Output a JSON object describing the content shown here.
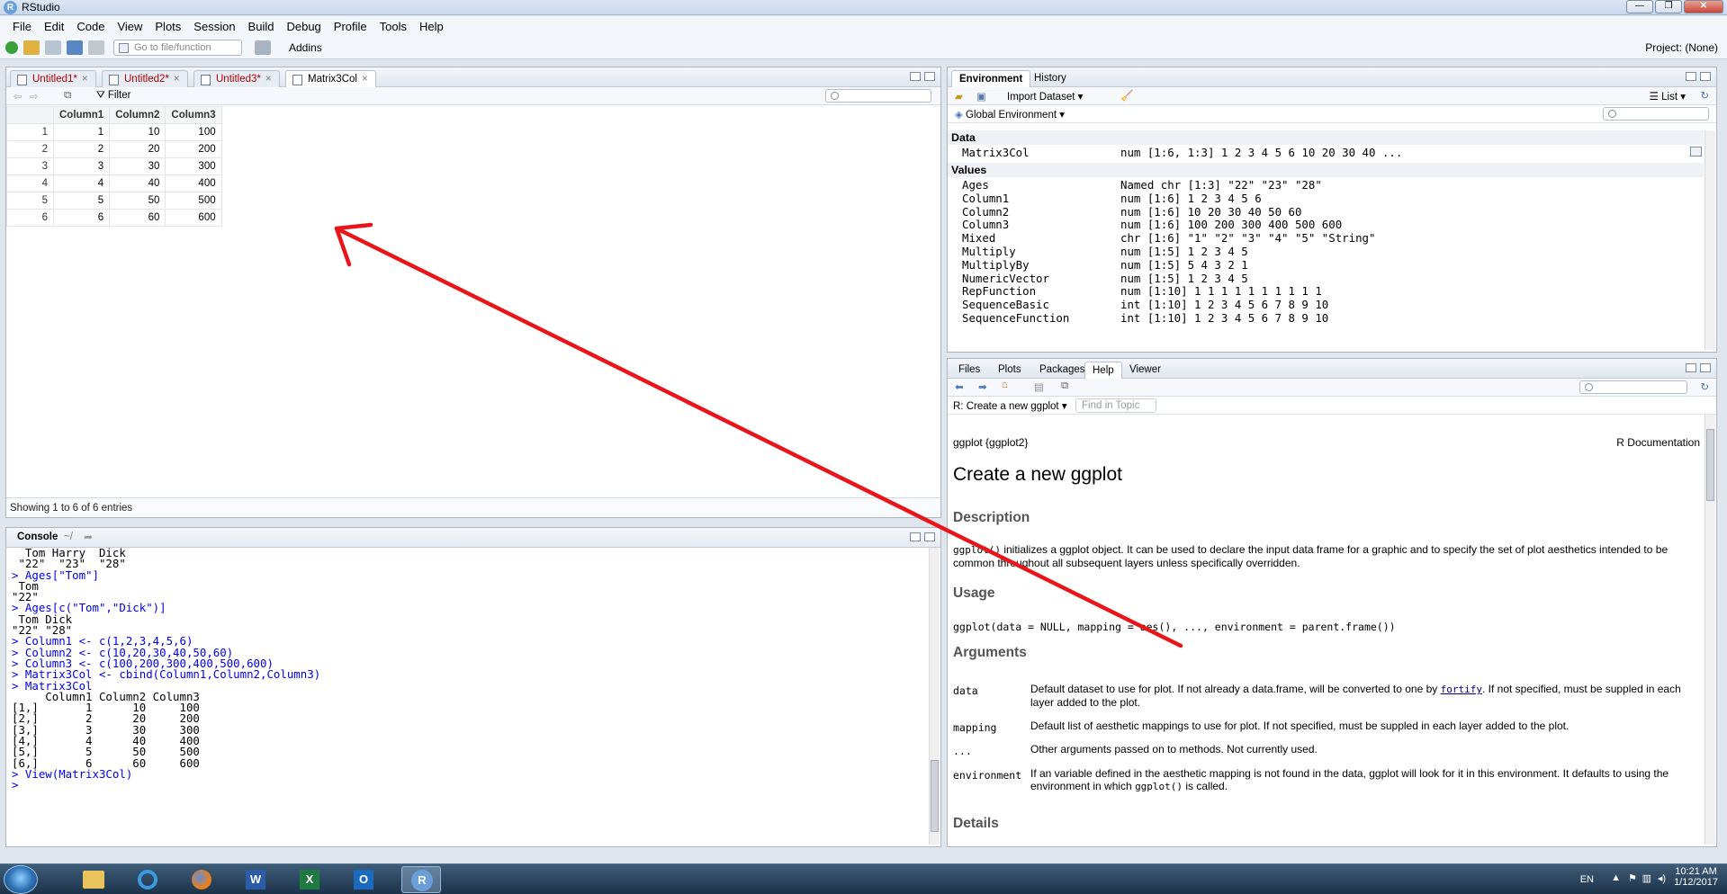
{
  "window": {
    "title": "RStudio",
    "controls": [
      "—",
      "❐",
      "✕"
    ]
  },
  "menu": [
    "File",
    "Edit",
    "Code",
    "View",
    "Plots",
    "Session",
    "Build",
    "Debug",
    "Profile",
    "Tools",
    "Help"
  ],
  "toolbar": {
    "goto_placeholder": "Go to file/function",
    "addins_label": "Addins",
    "project_label": "Project: (None)"
  },
  "source": {
    "tabs": [
      {
        "label": "Untitled1*",
        "modified": true
      },
      {
        "label": "Untitled2*",
        "modified": true
      },
      {
        "label": "Untitled3*",
        "modified": true
      },
      {
        "label": "Matrix3Col",
        "modified": false,
        "active": true
      }
    ],
    "filter_label": "Filter",
    "table": {
      "columns": [
        "",
        "Column1",
        "Column2",
        "Column3"
      ],
      "rows": [
        [
          "1",
          "1",
          "10",
          "100"
        ],
        [
          "2",
          "2",
          "20",
          "200"
        ],
        [
          "3",
          "3",
          "30",
          "300"
        ],
        [
          "4",
          "4",
          "40",
          "400"
        ],
        [
          "5",
          "5",
          "50",
          "500"
        ],
        [
          "6",
          "6",
          "60",
          "600"
        ]
      ]
    },
    "showing": "Showing 1 to 6 of 6 entries"
  },
  "console": {
    "title": "Console",
    "path": "~/",
    "lines": [
      {
        "t": "out",
        "s": "  Tom Harry  Dick "
      },
      {
        "t": "out",
        "s": " \"22\"  \"23\"  \"28\" "
      },
      {
        "t": "cmd",
        "s": "> Ages[\"Tom\"]"
      },
      {
        "t": "out",
        "s": " Tom "
      },
      {
        "t": "out",
        "s": "\"22\" "
      },
      {
        "t": "cmd",
        "s": "> Ages[c(\"Tom\",\"Dick\")]"
      },
      {
        "t": "out",
        "s": " Tom Dick "
      },
      {
        "t": "out",
        "s": "\"22\" \"28\" "
      },
      {
        "t": "cmd",
        "s": "> Column1 <- c(1,2,3,4,5,6)"
      },
      {
        "t": "cmd",
        "s": "> Column2 <- c(10,20,30,40,50,60)"
      },
      {
        "t": "cmd",
        "s": "> Column3 <- c(100,200,300,400,500,600)"
      },
      {
        "t": "cmd",
        "s": "> Matrix3Col <- cbind(Column1,Column2,Column3)"
      },
      {
        "t": "cmd",
        "s": "> Matrix3Col"
      },
      {
        "t": "out",
        "s": "     Column1 Column2 Column3"
      },
      {
        "t": "out",
        "s": "[1,]       1      10     100"
      },
      {
        "t": "out",
        "s": "[2,]       2      20     200"
      },
      {
        "t": "out",
        "s": "[3,]       3      30     300"
      },
      {
        "t": "out",
        "s": "[4,]       4      40     400"
      },
      {
        "t": "out",
        "s": "[5,]       5      50     500"
      },
      {
        "t": "out",
        "s": "[6,]       6      60     600"
      },
      {
        "t": "cmd",
        "s": "> View(Matrix3Col)"
      },
      {
        "t": "cmd",
        "s": "> "
      }
    ]
  },
  "environment": {
    "tabs": [
      "Environment",
      "History"
    ],
    "import_label": "Import Dataset",
    "list_label": "List",
    "scope_label": "Global Environment",
    "data_heading": "Data",
    "data": [
      {
        "name": "Matrix3Col",
        "value": "num [1:6, 1:3] 1 2 3 4 5 6 10 20 30 40 ..."
      }
    ],
    "values_heading": "Values",
    "values": [
      {
        "name": "Ages",
        "value": "Named chr [1:3] \"22\" \"23\" \"28\""
      },
      {
        "name": "Column1",
        "value": "num [1:6] 1 2 3 4 5 6"
      },
      {
        "name": "Column2",
        "value": "num [1:6] 10 20 30 40 50 60"
      },
      {
        "name": "Column3",
        "value": "num [1:6] 100 200 300 400 500 600"
      },
      {
        "name": "Mixed",
        "value": "chr [1:6] \"1\" \"2\" \"3\" \"4\" \"5\" \"String\""
      },
      {
        "name": "Multiply",
        "value": "num [1:5] 1 2 3 4 5"
      },
      {
        "name": "MultiplyBy",
        "value": "num [1:5] 5 4 3 2 1"
      },
      {
        "name": "NumericVector",
        "value": "num [1:5] 1 2 3 4 5"
      },
      {
        "name": "RepFunction",
        "value": "num [1:10] 1 1 1 1 1 1 1 1 1 1"
      },
      {
        "name": "SequenceBasic",
        "value": "int [1:10] 1 2 3 4 5 6 7 8 9 10"
      },
      {
        "name": "SequenceFunction",
        "value": "int [1:10] 1 2 3 4 5 6 7 8 9 10"
      }
    ]
  },
  "help": {
    "tabs": [
      "Files",
      "Plots",
      "Packages",
      "Help",
      "Viewer"
    ],
    "topic_label": "R: Create a new ggplot",
    "find_placeholder": "Find in Topic",
    "pkg": "ggplot {ggplot2}",
    "rdoc": "R Documentation",
    "title": "Create a new ggplot",
    "desc_heading": "Description",
    "desc_code": "ggplot()",
    "desc_text": " initializes a ggplot object. It can be used to declare the input data frame for a graphic and to specify the set of plot aesthetics intended to be common throughout all subsequent layers unless specifically overridden.",
    "usage_heading": "Usage",
    "usage": "ggplot(data = NULL, mapping = aes(), ..., environment = parent.frame())",
    "args_heading": "Arguments",
    "args": [
      {
        "name": "data",
        "pre": "Default dataset to use for plot. If not already a data.frame, will be converted to one by ",
        "link": "fortify",
        "post": ". If not specified, must be suppled in each layer added to the plot."
      },
      {
        "name": "mapping",
        "pre": "Default list of aesthetic mappings to use for plot. If not specified, must be suppled in each layer added to the plot.",
        "link": "",
        "post": ""
      },
      {
        "name": "...",
        "pre": "Other arguments passed on to methods. Not currently used.",
        "link": "",
        "post": ""
      },
      {
        "name": "environment",
        "pre": "If an variable defined in the aesthetic mapping is not found in the data, ggplot will look for it in this environment. It defaults to using the environment in which ",
        "link": "",
        "code": "ggplot()",
        "post": " is called."
      }
    ],
    "details_heading": "Details"
  },
  "taskbar": {
    "lang": "EN",
    "time": "10:21 AM",
    "date": "1/12/2017"
  },
  "annotation_color": "#e8161b"
}
